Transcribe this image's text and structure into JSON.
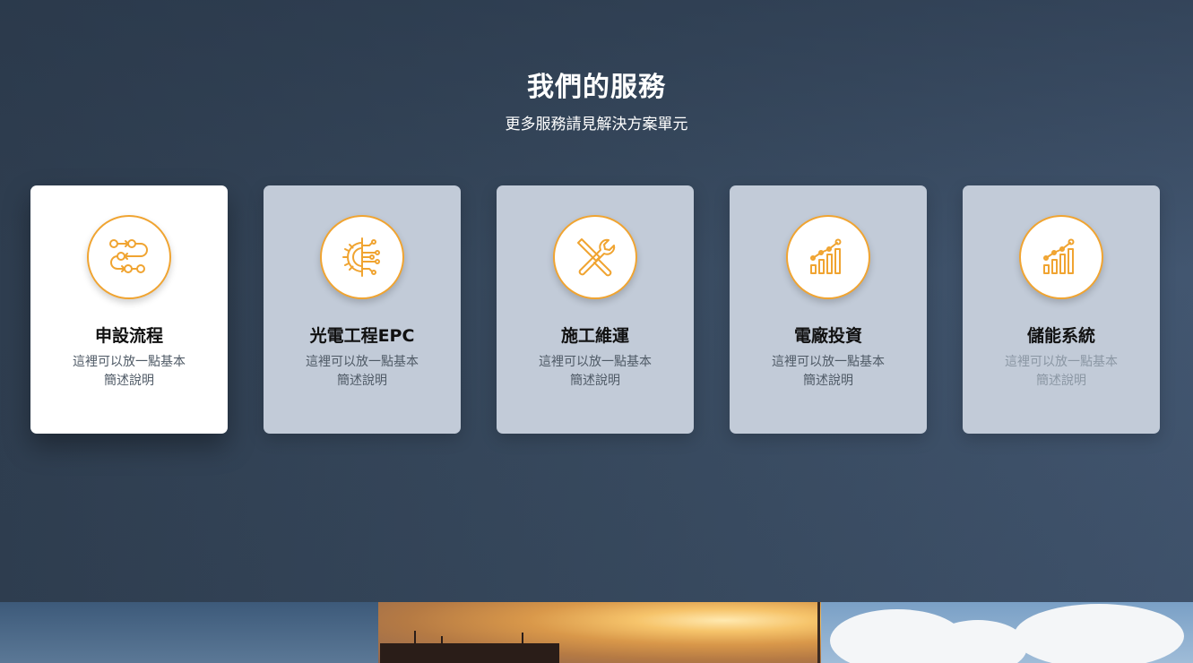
{
  "services": {
    "title": "我們的服務",
    "subtitle": "更多服務請見解決方案單元",
    "cards": [
      {
        "title": "申設流程",
        "desc_line1": "這裡可以放一點基本",
        "desc_line2": "簡述說明",
        "icon": "process-flow-icon",
        "active": true
      },
      {
        "title": "光電工程EPC",
        "desc_line1": "這裡可以放一點基本",
        "desc_line2": "簡述說明",
        "icon": "gear-circuit-icon",
        "active": false
      },
      {
        "title": "施工維運",
        "desc_line1": "這裡可以放一點基本",
        "desc_line2": "簡述說明",
        "icon": "wrench-screwdriver-icon",
        "active": false
      },
      {
        "title": "電廠投資",
        "desc_line1": "這裡可以放一點基本",
        "desc_line2": "簡述說明",
        "icon": "growth-chart-icon",
        "active": false
      },
      {
        "title": "儲能系統",
        "desc_line1": "這裡可以放一點基本",
        "desc_line2": "簡述說明",
        "icon": "growth-chart-icon",
        "active": false
      }
    ]
  },
  "colors": {
    "accent": "#f0a431",
    "card_inactive": "#c2cbd8",
    "card_active": "#ffffff",
    "background": "#384a5f"
  }
}
